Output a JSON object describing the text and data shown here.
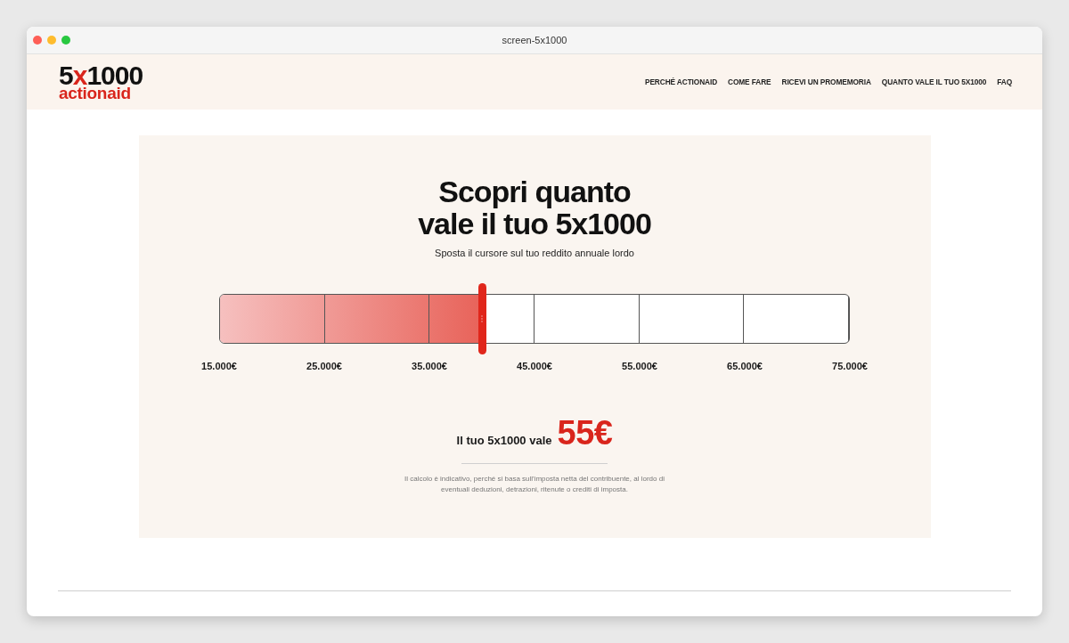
{
  "window": {
    "title": "screen-5x1000"
  },
  "header": {
    "logo": {
      "number_parts": [
        {
          "text": "5",
          "accent": false
        },
        {
          "text": "x",
          "accent": true
        },
        {
          "text": "1000",
          "accent": false
        }
      ],
      "wordmark": "actionaid"
    },
    "nav": [
      "PERCHÉ ACTIONAID",
      "COME FARE",
      "RICEVI UN PROMEMORIA",
      "QUANTO VALE IL TUO 5X1000",
      "FAQ"
    ]
  },
  "calculator": {
    "title_lines": [
      "Scopri quanto",
      "vale il tuo 5x1000"
    ],
    "subtitle": "Sposta il cursore sul tuo reddito annuale lordo",
    "slider": {
      "level": 0.4167,
      "ticks": [
        "15.000€",
        "25.000€",
        "35.000€",
        "45.000€",
        "55.000€",
        "65.000€",
        "75.000€"
      ]
    },
    "result": {
      "label": "Il tuo 5x1000 vale",
      "amount": "55€"
    },
    "disclaimer": "Il calcolo è indicativo, perché si basa sull'imposta netta del contribuente, al lordo di eventuali deduzioni, detrazioni, ritenute o crediti di imposta."
  }
}
